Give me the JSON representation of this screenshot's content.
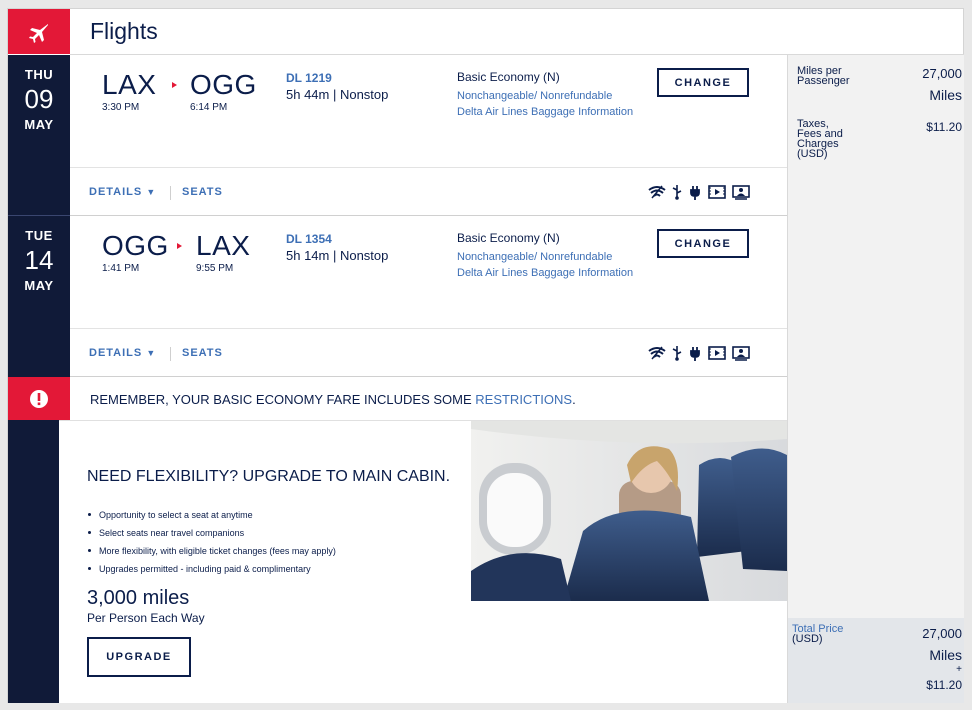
{
  "header": {
    "title": "Flights",
    "icon": "airplane-icon"
  },
  "flights": [
    {
      "date": {
        "dow": "THU",
        "day": "09",
        "month": "MAY"
      },
      "origin": {
        "code": "LAX",
        "time": "3:30 PM"
      },
      "destination": {
        "code": "OGG",
        "time": "6:14 PM"
      },
      "flight_number": "DL 1219",
      "duration": "5h 44m | Nonstop",
      "fare_class": "Basic Economy (N)",
      "fare_rules": "Nonchangeable/ Nonrefundable",
      "baggage_link": "Delta Air Lines Baggage Information",
      "change_label": "CHANGE",
      "details_label": "DETAILS",
      "seats_label": "SEATS"
    },
    {
      "date": {
        "dow": "TUE",
        "day": "14",
        "month": "MAY"
      },
      "origin": {
        "code": "OGG",
        "time": "1:41 PM"
      },
      "destination": {
        "code": "LAX",
        "time": "9:55 PM"
      },
      "flight_number": "DL 1354",
      "duration": "5h 14m | Nonstop",
      "fare_class": "Basic Economy (N)",
      "fare_rules": "Nonchangeable/ Nonrefundable",
      "baggage_link": "Delta Air Lines Baggage Information",
      "change_label": "CHANGE",
      "details_label": "DETAILS",
      "seats_label": "SEATS"
    }
  ],
  "amenities": [
    "wifi-icon",
    "usb-icon",
    "power-icon",
    "entertainment-icon",
    "seatback-screen-icon"
  ],
  "alert": {
    "text_before": "REMEMBER, YOUR BASIC ECONOMY FARE INCLUDES SOME ",
    "link": "RESTRICTIONS",
    "text_after": "."
  },
  "promo": {
    "title": "NEED FLEXIBILITY? UPGRADE TO MAIN CABIN.",
    "bullets": [
      "Opportunity to select a seat at anytime",
      "Select seats near travel companions",
      "More flexibility, with eligible ticket changes (fees may apply)",
      "Upgrades permitted - including paid & complimentary"
    ],
    "miles": "3,000 miles",
    "miles_sub": "Per Person Each Way",
    "button": "UPGRADE"
  },
  "sidebar": {
    "miles_label_1": "Miles per",
    "miles_label_2": "Passenger",
    "miles_value": "27,000",
    "miles_unit": "Miles",
    "taxes_label_1": "Taxes,",
    "taxes_label_2": "Fees and",
    "taxes_label_3": "Charges",
    "taxes_label_4": "(USD)",
    "taxes_value": "$11.20",
    "total_label_1": "Total Price",
    "total_label_2": "(USD)",
    "total_miles": "27,000",
    "total_unit": "Miles",
    "total_plus": "+",
    "total_taxes": "$11.20"
  },
  "colors": {
    "brand_red": "#e31837",
    "navy": "#101a38",
    "link": "#3d6fb5"
  }
}
